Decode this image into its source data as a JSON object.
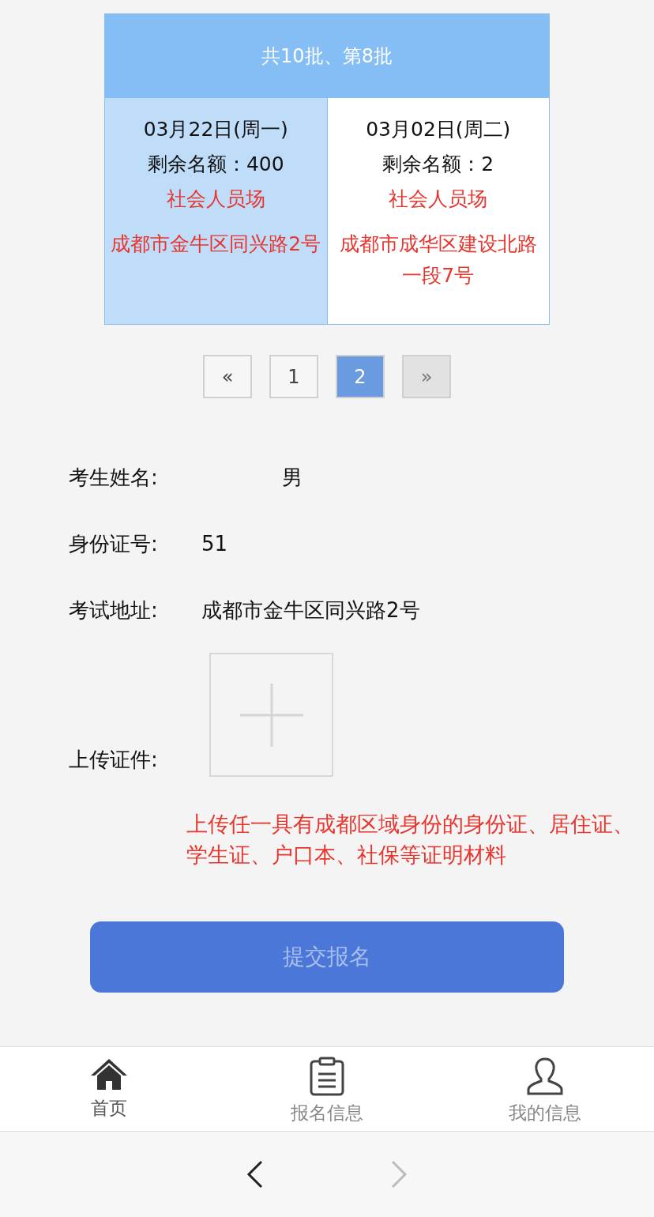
{
  "batch_table": {
    "header": "共10批、第8批",
    "sessions": [
      {
        "date": "03月22日(周一)",
        "quota": "剩余名额：400",
        "type": "社会人员场",
        "address": "成都市金牛区同兴路2号",
        "selected": true
      },
      {
        "date": "03月02日(周二)",
        "quota": "剩余名额：2",
        "type": "社会人员场",
        "address": "成都市成华区建设北路一段7号",
        "selected": false
      }
    ]
  },
  "pagination": {
    "prev": {
      "label": "«",
      "disabled": false
    },
    "pages": [
      {
        "label": "1",
        "selected": false
      },
      {
        "label": "2",
        "selected": true
      }
    ],
    "next": {
      "label": "»",
      "disabled": true
    }
  },
  "form": {
    "name_label": "考生姓名:",
    "gender": "男",
    "id_label": "身份证号:",
    "id_value": "51",
    "address_label": "考试地址:",
    "address_value": "成都市金牛区同兴路2号",
    "upload_label": "上传证件:",
    "upload_hint": "上传任一具有成都区域身份的身份证、居住证、学生证、户口本、社保等证明材料"
  },
  "submit": {
    "label": "提交报名",
    "disabled": true
  },
  "tab_bar": [
    {
      "kind": "home",
      "label": "首页",
      "selected": true
    },
    {
      "kind": "clipboard",
      "label": "报名信息",
      "selected": false
    },
    {
      "kind": "user",
      "label": "我的信息",
      "selected": false
    }
  ],
  "browser_nav": {
    "back_disabled": false,
    "forward_disabled": true
  }
}
